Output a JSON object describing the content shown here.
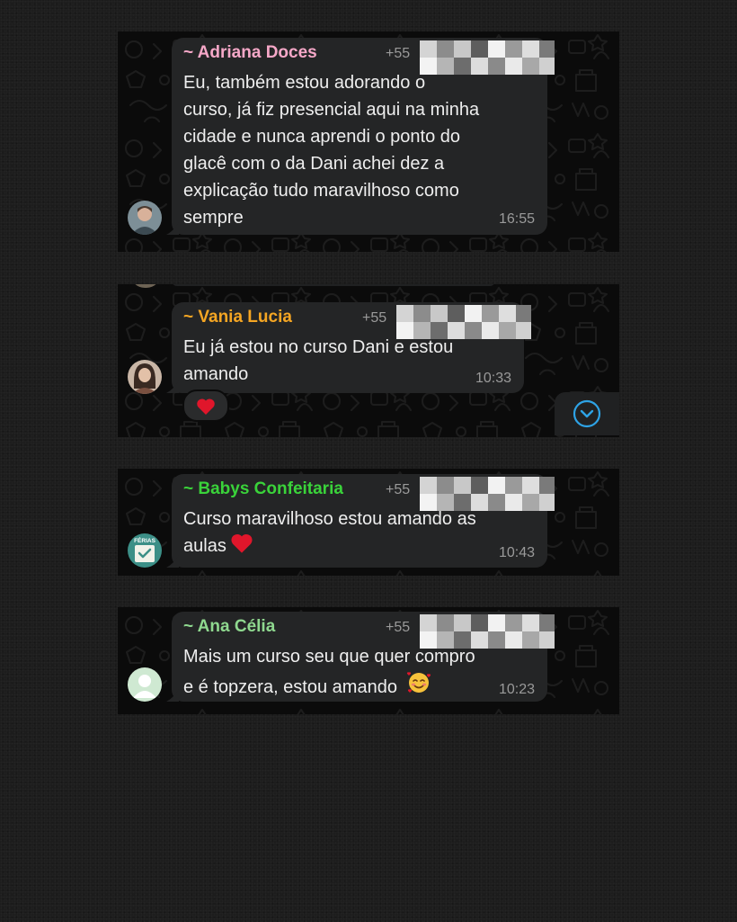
{
  "messages": [
    {
      "sender": "~ Adriana Doces",
      "sender_color": "#f6a8c8",
      "phone_prefix": "+55",
      "text": "Eu, também estou adorando o\ncurso, já fiz presencial aqui na minha\ncidade e nunca aprendi o ponto do\nglacê com o da Dani  achei dez a\nexplicação tudo maravilhoso como\nsempre",
      "time": "16:55"
    },
    {
      "sender": "~ Vania Lucia",
      "sender_color": "#f5a623",
      "phone_prefix": "+55",
      "text": "Eu já estou no curso Dani e estou\namando",
      "time": "10:33",
      "reaction": "heart-emoji"
    },
    {
      "sender": "~ Babys Confeitaria",
      "sender_color": "#3ad33a",
      "phone_prefix": "+55",
      "text": "Curso maravilhoso estou amando as\naulas",
      "time": "10:43",
      "avatar_label": "FÉRIAS"
    },
    {
      "sender": "~ Ana Célia",
      "sender_color": "#8fd88f",
      "phone_prefix": "+55",
      "text": "Mais um curso seu que quer compro\ne é topzera, estou amando",
      "time": "10:23"
    }
  ],
  "icons": {
    "scroll_down": "chevron-down-circle-icon",
    "reaction": "heart-emoji",
    "inline_emoji_3": "heart-emoji",
    "inline_emoji_4": "smiling-face-with-hearts-emoji"
  },
  "colors": {
    "bubble": "#242526",
    "panel": "#0b0b0b",
    "timestamp": "#9a9a9a",
    "accent_blue": "#2ea3e6"
  }
}
